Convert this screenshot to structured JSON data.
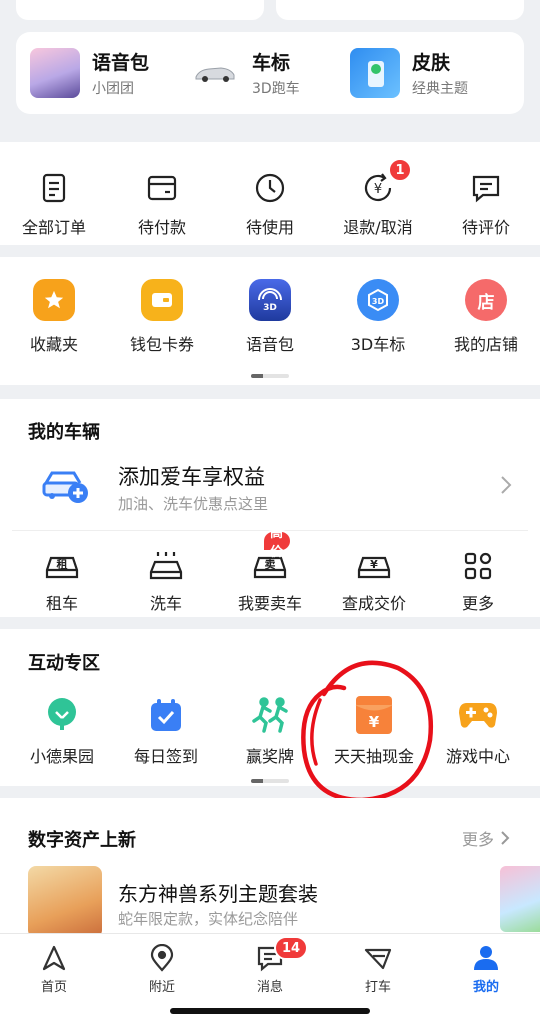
{
  "packages": [
    {
      "title": "语音包",
      "sub": "小团团"
    },
    {
      "title": "车标",
      "sub": "3D跑车"
    },
    {
      "title": "皮肤",
      "sub": "经典主题"
    }
  ],
  "orders": [
    {
      "label": "全部订单",
      "icon": "list-icon"
    },
    {
      "label": "待付款",
      "icon": "wallet-icon"
    },
    {
      "label": "待使用",
      "icon": "clock-icon"
    },
    {
      "label": "退款/取消",
      "icon": "refund-icon",
      "badge": "1"
    },
    {
      "label": "待评价",
      "icon": "comment-icon"
    }
  ],
  "tools": [
    {
      "label": "收藏夹",
      "icon": "star-icon",
      "color": "#f7a21b"
    },
    {
      "label": "钱包卡券",
      "icon": "wallet-card-icon",
      "color": "#f7a21b"
    },
    {
      "label": "语音包",
      "icon": "voice-3d-icon",
      "color": "#2a4bb8"
    },
    {
      "label": "3D车标",
      "icon": "car-logo-3d-icon",
      "color": "#3a8cf5"
    },
    {
      "label": "我的店铺",
      "icon": "shop-icon",
      "color": "#f56a6a"
    }
  ],
  "vehicle": {
    "section_title": "我的车辆",
    "add_title": "添加爱车享权益",
    "add_sub": "加油、洗车优惠点这里",
    "items": [
      {
        "label": "租车",
        "icon": "rent-car-icon",
        "glyph": "租"
      },
      {
        "label": "洗车",
        "icon": "car-wash-icon"
      },
      {
        "label": "我要卖车",
        "icon": "sell-car-icon",
        "glyph": "卖",
        "tag": "高价"
      },
      {
        "label": "查成交价",
        "icon": "price-car-icon",
        "glyph": "¥"
      },
      {
        "label": "更多",
        "icon": "more-grid-icon"
      }
    ]
  },
  "interactive": {
    "section_title": "互动专区",
    "items": [
      {
        "label": "小德果园",
        "icon": "orchard-icon",
        "color": "#2fc497"
      },
      {
        "label": "每日签到",
        "icon": "calendar-check-icon",
        "color": "#3a7ff5"
      },
      {
        "label": "赢奖牌",
        "icon": "running-icon",
        "color": "#2fc497"
      },
      {
        "label": "天天抽现金",
        "icon": "red-envelope-icon",
        "color": "#f7823a"
      },
      {
        "label": "游戏中心",
        "icon": "gamepad-icon",
        "color": "#f7a21b"
      }
    ]
  },
  "digital": {
    "section_title": "数字资产上新",
    "more_label": "更多",
    "card_title": "东方神兽系列主题套装",
    "card_sub": "蛇年限定款，实体纪念陪伴"
  },
  "nav": [
    {
      "label": "首页",
      "icon": "navigate-arrow-icon",
      "active": false
    },
    {
      "label": "附近",
      "icon": "location-pin-icon",
      "active": false
    },
    {
      "label": "消息",
      "icon": "message-icon",
      "active": false,
      "badge": "14"
    },
    {
      "label": "打车",
      "icon": "taxi-flag-icon",
      "active": false
    },
    {
      "label": "我的",
      "icon": "profile-icon",
      "active": true
    }
  ],
  "colors": {
    "accent": "#1a6cf0",
    "badge": "#f03a3a",
    "annotation": "#e8101a"
  }
}
